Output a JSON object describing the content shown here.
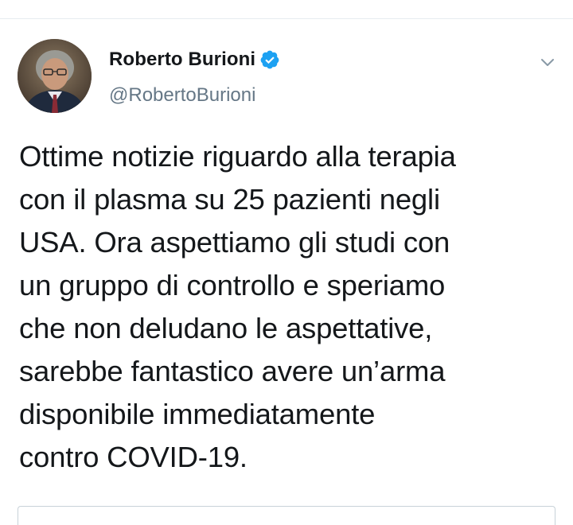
{
  "tweet": {
    "author": {
      "display_name": "Roberto Burioni",
      "handle": "@RobertoBurioni",
      "verified": true,
      "avatar_icon": "profile-photo"
    },
    "text": "Ottime notizie riguardo alla terapia\ncon il plasma su 25 pazienti negli\nUSA. Ora aspettiamo gli studi con\nun gruppo di controllo e speriamo\nche non deludano le aspettative,\nsarebbe fantastico avere un’arma\ndisponibile immediatamente\ncontro COVID-19.",
    "menu_icon": "chevron-down-icon"
  },
  "colors": {
    "text_primary": "#14171a",
    "text_secondary": "#657786",
    "verified_blue": "#1da1f2",
    "divider": "#e6ecf0"
  }
}
